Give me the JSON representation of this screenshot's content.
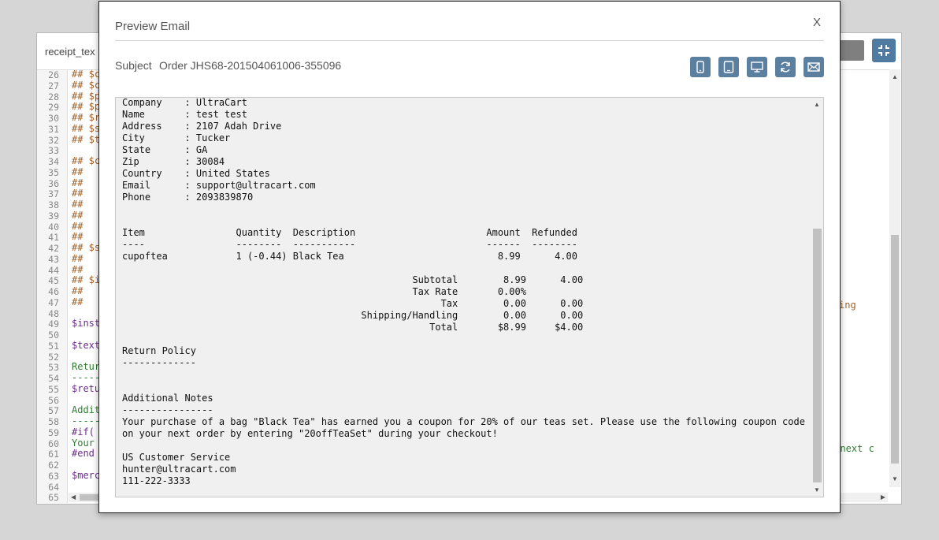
{
  "editor": {
    "tab_label": "receipt_tex",
    "line_numbers": [
      "26",
      "27",
      "28",
      "29",
      "30",
      "31",
      "32",
      "33",
      "34",
      "35",
      "36",
      "37",
      "38",
      "39",
      "40",
      "41",
      "42",
      "43",
      "44",
      "45",
      "46",
      "47",
      "48",
      "49",
      "50",
      "51",
      "52",
      "53",
      "54",
      "55",
      "56",
      "57",
      "58",
      "59",
      "60",
      "61",
      "62",
      "63",
      "64",
      "65"
    ],
    "code_lines": [
      "## $c",
      "## $c",
      "## $p",
      "## $p",
      "## $r",
      "## $s",
      "## $t",
      "",
      "## $c",
      "##",
      "##",
      "##",
      "##",
      "##",
      "##",
      "##",
      "## $s",
      "##",
      "##",
      "## $i",
      "##",
      "##",
      "",
      "$inst",
      "",
      "$text",
      "",
      "Retur",
      "-----",
      "$retu",
      "",
      "Addit",
      "-----",
      "#if(",
      "Your",
      "#end",
      "",
      "$merc",
      "",
      ""
    ],
    "right_fragment_1": "ing",
    "right_fragment_2": "r next c"
  },
  "modal": {
    "title": "Preview Email",
    "close_label": "X",
    "subject_label": "Subject",
    "subject_value": "Order JHS68-201504061006-355096",
    "toolbar_icons": [
      "phone-icon",
      "tablet-icon",
      "desktop-icon",
      "refresh-icon",
      "send-email-icon"
    ],
    "preview_lines": [
      "Company    : UltraCart",
      "Name       : test test",
      "Address    : 2107 Adah Drive",
      "City       : Tucker",
      "State      : GA",
      "Zip        : 30084",
      "Country    : United States",
      "Email      : support@ultracart.com",
      "Phone      : 2093839870",
      "",
      "",
      "Item                Quantity  Description                       Amount  Refunded",
      "----                --------  -----------                       ------  --------",
      "cupoftea            1 (-0.44) Black Tea                           8.99      4.00",
      "",
      "                                                   Subtotal        8.99      4.00",
      "                                                   Tax Rate       0.00%",
      "                                                        Tax        0.00      0.00",
      "                                          Shipping/Handling        0.00      0.00",
      "                                                      Total       $8.99     $4.00",
      "",
      "Return Policy",
      "-------------",
      "",
      "",
      "Additional Notes",
      "----------------",
      "Your purchase of a bag \"Black Tea\" has earned you a coupon for 20% of our teas set. Please use the following coupon code",
      "on your next order by entering \"20offTeaSet\" during your checkout!",
      "",
      "US Customer Service",
      "hunter@ultracart.com",
      "111-222-3333"
    ]
  },
  "colors": {
    "accent": "#5b7f9f",
    "comment": "#a0632b",
    "variable": "#6b2d8a",
    "text": "#2e7d32"
  }
}
